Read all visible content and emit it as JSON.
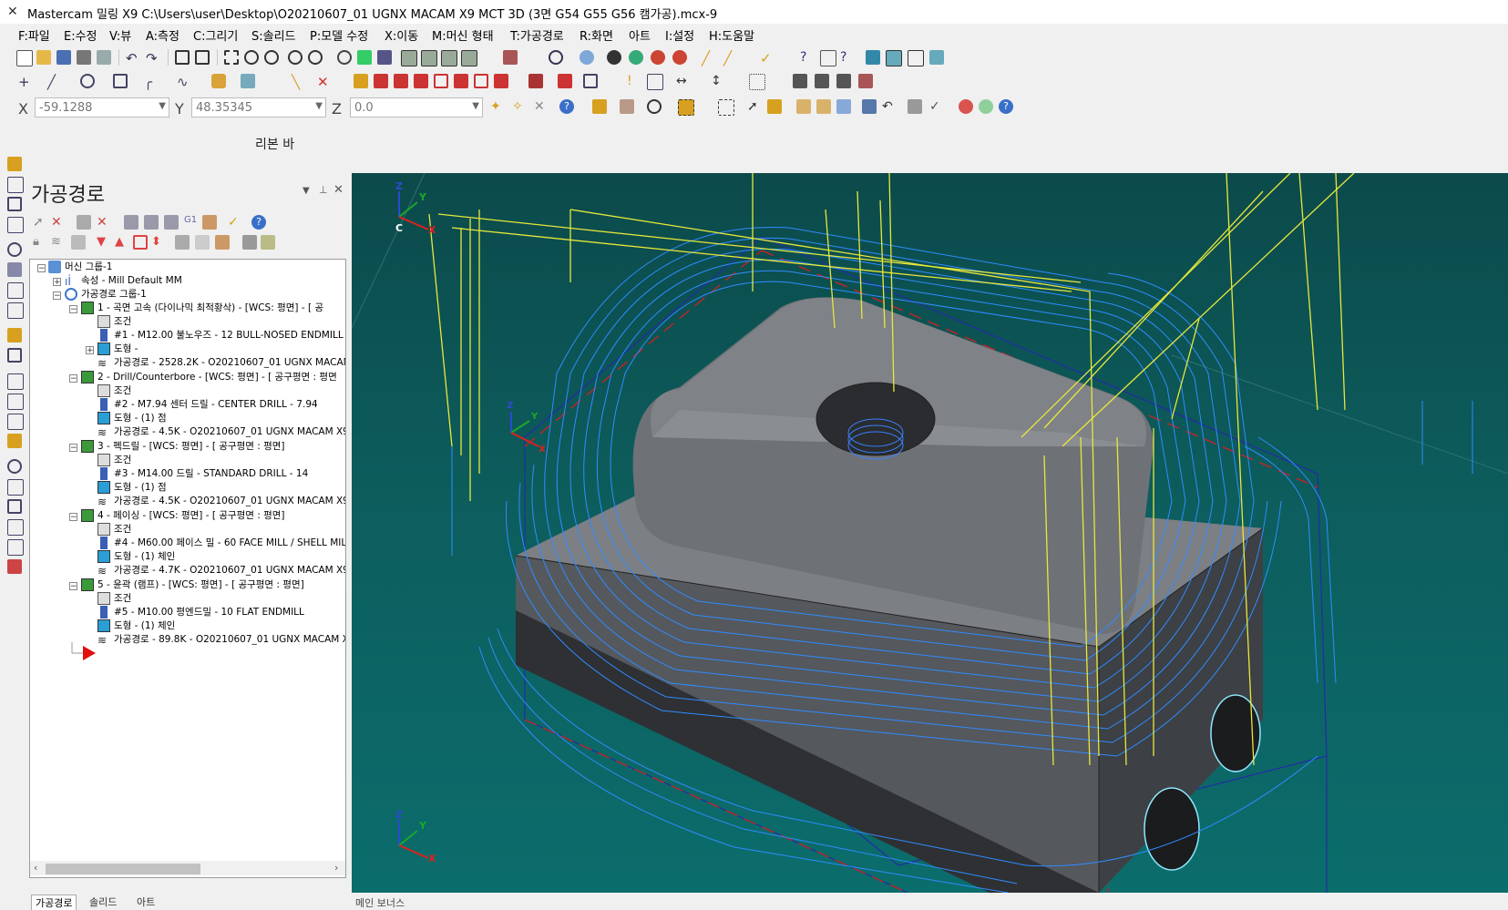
{
  "window": {
    "title": "Mastercam 밀링 X9  C:\\Users\\user\\Desktop\\O20210607_01 UGNX MACAM X9 MCT 3D (3면 G54 G55 G56 캠가공).mcx-9"
  },
  "menu": [
    "F:파일",
    "E:수정",
    "V:뷰",
    "A:측정",
    "C:그리기",
    "S:솔리드",
    "P:모델 수정",
    "X:이동",
    "M:머신 형태",
    "T:가공경로",
    "R:화면",
    "아트",
    "I:설정",
    "H:도움말"
  ],
  "coords": {
    "x_label": "X",
    "x_value": "-59.1288",
    "y_label": "Y",
    "y_value": "48.35345",
    "z_label": "Z",
    "z_value": "0.0"
  },
  "ribbon_label": "리본 바",
  "panel": {
    "title": "가공경로",
    "tree": [
      {
        "text": "머신 그룹-1",
        "icon": "machine-group-icon"
      },
      {
        "text": "속성 - Mill Default MM",
        "icon": "properties-icon"
      },
      {
        "text": "가공경로 그룹-1",
        "icon": "toolpath-group-icon"
      },
      {
        "text": "1 - 곡면 고속 (다이나믹 최적황삭) - [WCS: 평면] - [ 공",
        "icon": "operation-icon"
      },
      {
        "text": "조건",
        "icon": "folder-icon"
      },
      {
        "text": "#1 - M12.00 불노우즈 - 12 BULL-NOSED ENDMILL",
        "icon": "tool-icon"
      },
      {
        "text": "도형 -",
        "icon": "geometry-icon"
      },
      {
        "text": "가공경로 - 2528.2K - O20210607_01 UGNX MACAM",
        "icon": "toolpath-icon"
      },
      {
        "text": "2 - Drill/Counterbore - [WCS: 평면] - [ 공구평면 : 평면",
        "icon": "operation-icon"
      },
      {
        "text": "조건",
        "icon": "folder-icon"
      },
      {
        "text": "#2 - M7.94 센터 드릴 - CENTER DRILL - 7.94",
        "icon": "tool-icon"
      },
      {
        "text": "도형 - (1) 점",
        "icon": "geometry-icon"
      },
      {
        "text": "가공경로 - 4.5K - O20210607_01 UGNX MACAM X9",
        "icon": "toolpath-icon"
      },
      {
        "text": "3 - 펙드릴 - [WCS: 평면] - [ 공구평면 : 평면]",
        "icon": "operation-icon"
      },
      {
        "text": "조건",
        "icon": "folder-icon"
      },
      {
        "text": "#3 - M14.00 드릴 - STANDARD DRILL - 14",
        "icon": "tool-icon"
      },
      {
        "text": "도형 - (1) 점",
        "icon": "geometry-icon"
      },
      {
        "text": "가공경로 - 4.5K - O20210607_01 UGNX MACAM X9",
        "icon": "toolpath-icon"
      },
      {
        "text": "4 - 페이싱 - [WCS: 평면] - [ 공구평면 : 평면]",
        "icon": "operation-icon"
      },
      {
        "text": "조건",
        "icon": "folder-icon"
      },
      {
        "text": "#4 - M60.00 페이스 밀 - 60 FACE MILL / SHELL MIL",
        "icon": "tool-icon"
      },
      {
        "text": "도형 - (1) 체인",
        "icon": "geometry-icon"
      },
      {
        "text": "가공경로 - 4.7K - O20210607_01 UGNX MACAM X9",
        "icon": "toolpath-icon"
      },
      {
        "text": "5 - 윤곽 (램프) - [WCS: 평면] - [ 공구평면 : 평면]",
        "icon": "operation-icon"
      },
      {
        "text": "조건",
        "icon": "folder-icon"
      },
      {
        "text": "#5 - M10.00 평엔드밀 - 10 FLAT ENDMILL",
        "icon": "tool-icon"
      },
      {
        "text": "도형 - (1) 체인",
        "icon": "geometry-icon"
      },
      {
        "text": "가공경로 - 89.8K - O20210607_01 UGNX MACAM X",
        "icon": "toolpath-icon"
      }
    ],
    "tabs": [
      "가공경로",
      "솔리드",
      "아트"
    ]
  },
  "viewport": {
    "axis_top": {
      "x": "X",
      "y": "Y",
      "z": "Z",
      "c": "C"
    },
    "axis_bottom": {
      "x": "X",
      "y": "Y",
      "z": "Z"
    },
    "axis_mid": {
      "x": "X",
      "y": "Y",
      "z": "Z"
    }
  },
  "status": "메인 보너스",
  "colors": {
    "viewport_bg": "#0d5d5d",
    "toolpath_blue": "#2f8cff",
    "rapid_yellow": "#e8e83a",
    "stock_red": "#d02020",
    "part_gray": "#7c7f84"
  }
}
